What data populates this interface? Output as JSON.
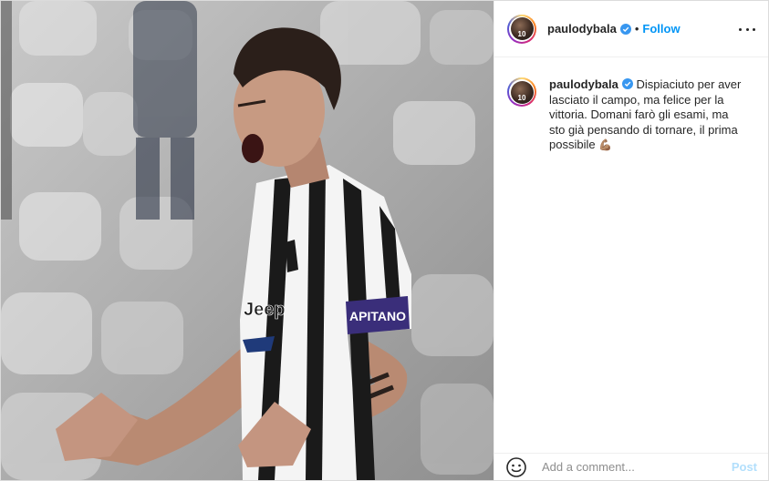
{
  "post": {
    "image_alt": "Footballer in black-and-white striped jersey celebrating with captain armband",
    "jersey_armband": "APITANO",
    "jersey_sponsor": "Jeep"
  },
  "header": {
    "username": "paulodybala",
    "dot": "•",
    "follow_label": "Follow",
    "avatar_number": "10"
  },
  "caption": {
    "username": "paulodybala",
    "text": "Dispiaciuto per aver lasciato il campo, ma felice per la vittoria. Domani farò gli esami, ma sto già pensando di tornare, il prima possibile",
    "emoji": "💪🏽"
  },
  "comment_box": {
    "placeholder": "Add a comment...",
    "post_label": "Post"
  },
  "colors": {
    "link_blue": "#0095f6",
    "post_disabled": "#b2dffc",
    "verified_blue": "#3897f0"
  },
  "icons": [
    "verified-badge-icon",
    "more-options-icon",
    "emoji-smile-icon"
  ]
}
